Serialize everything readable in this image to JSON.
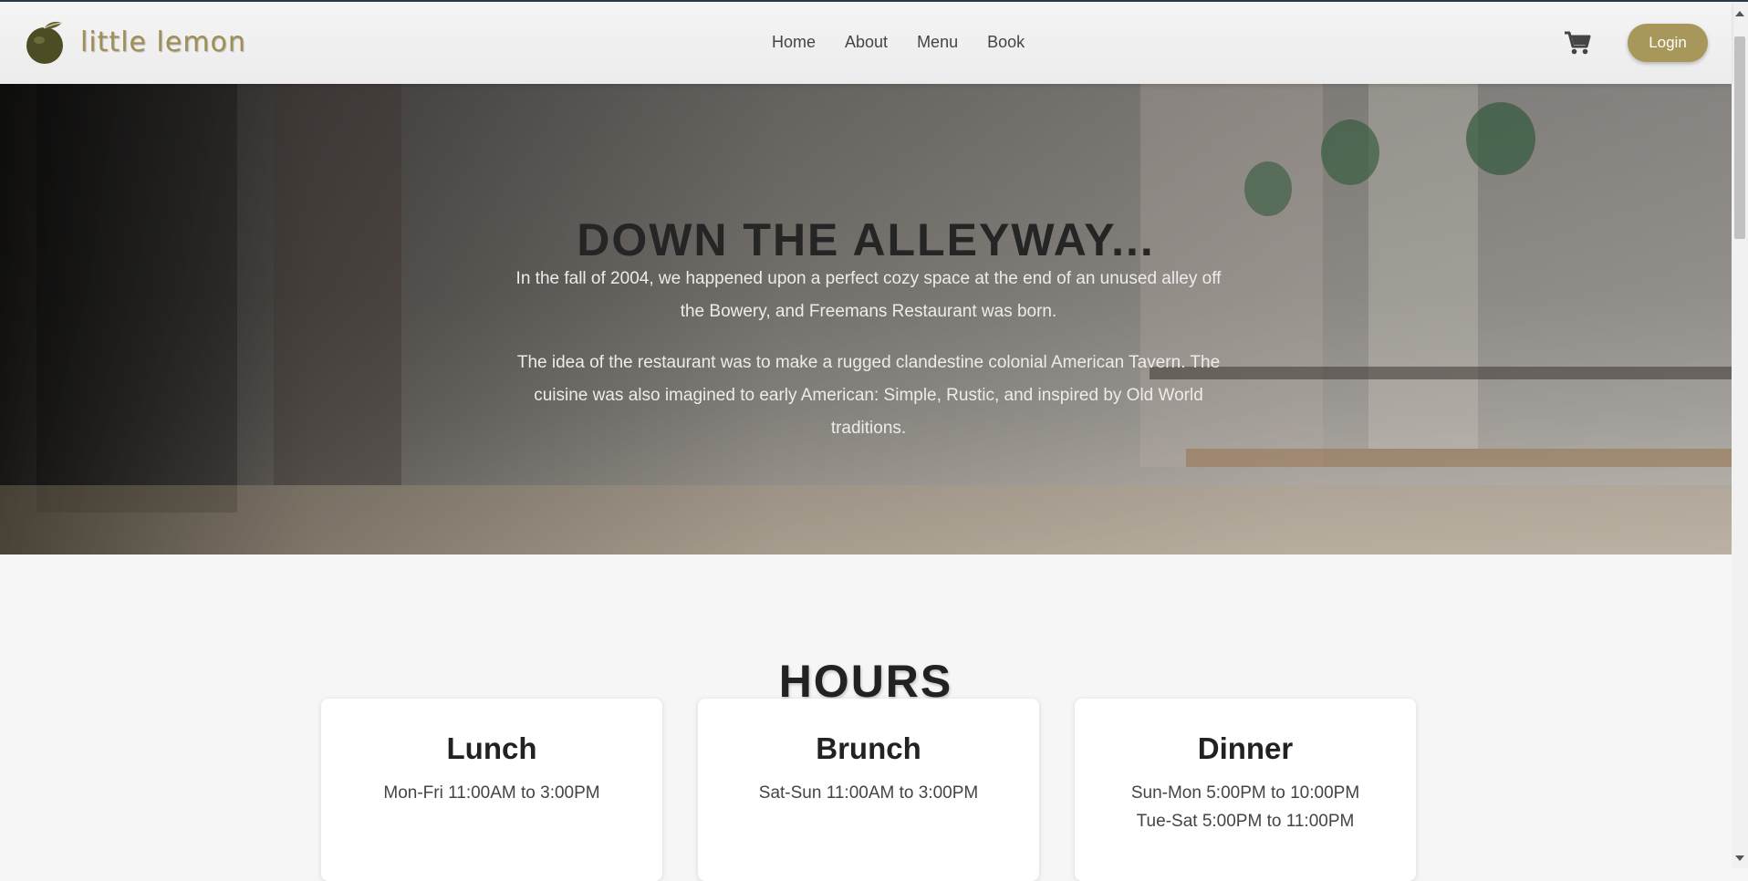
{
  "brand": {
    "name": "little lemon",
    "accent": "#a8975a"
  },
  "nav": {
    "links": [
      "Home",
      "About",
      "Menu",
      "Book"
    ]
  },
  "header": {
    "cart_icon": "shopping-cart-icon",
    "login_label": "Login"
  },
  "hero": {
    "title": "DOWN THE ALLEYWAY...",
    "paragraph1": "In the fall of 2004, we happened upon a perfect cozy space at the end of an unused alley off the Bowery, and Freemans Restaurant was born.",
    "paragraph2": "The idea of the restaurant was to make a rugged clandestine colonial American Tavern. The cuisine was also imagined to early American: Simple, Rustic, and inspired by Old World traditions."
  },
  "hours": {
    "title": "HOURS",
    "cards": [
      {
        "name": "Lunch",
        "lines": [
          "Mon-Fri 11:00AM to 3:00PM"
        ]
      },
      {
        "name": "Brunch",
        "lines": [
          "Sat-Sun 11:00AM to 3:00PM"
        ]
      },
      {
        "name": "Dinner",
        "lines": [
          "Sun-Mon 5:00PM to 10:00PM",
          "Tue-Sat 5:00PM to 11:00PM"
        ]
      }
    ]
  }
}
